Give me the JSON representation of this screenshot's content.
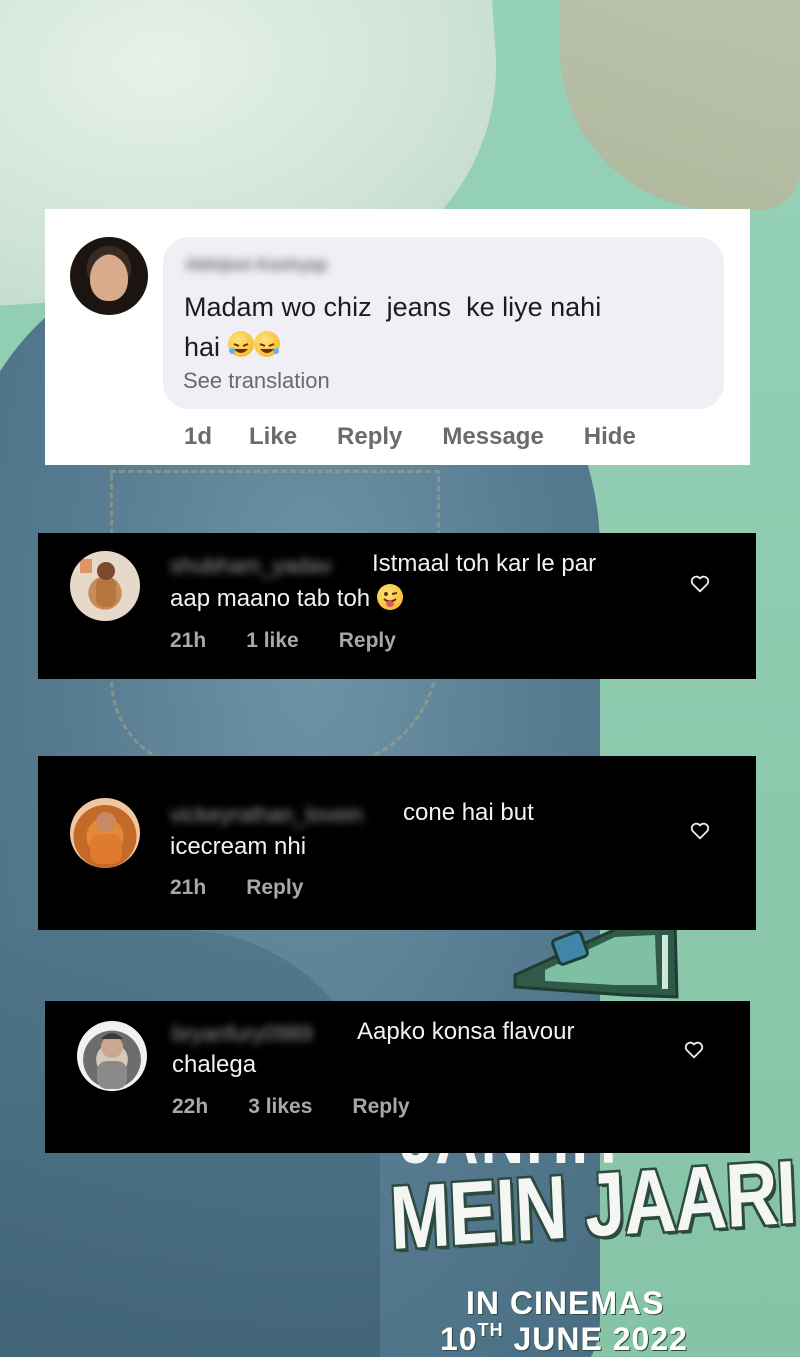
{
  "poster": {
    "title_top": "JANHIT",
    "title_main": "MEIN JAARI",
    "cinemas_line": "IN CINEMAS",
    "release_day": "10",
    "release_suffix": "TH",
    "release_rest": "JUNE 2022"
  },
  "facebook_comment": {
    "author": "Abhijeet Kashyap",
    "text": "Madam wo chiz  jeans  ke liye nahi\nhai",
    "emoji": [
      "rolling-on-floor-laughing-emoji",
      "rolling-on-floor-laughing-emoji"
    ],
    "see_translation": "See translation",
    "time": "1d",
    "actions": [
      "Like",
      "Reply",
      "Message",
      "Hide"
    ]
  },
  "instagram_comments": [
    {
      "author": "shubham_yadav",
      "text_first": "Istmaal toh kar le par",
      "text_second": "aap maano tab toh",
      "emoji": "winking-face-with-tongue-emoji",
      "time": "21h",
      "likes": "1 like",
      "reply": "Reply"
    },
    {
      "author": "vickeyrathan_lovein",
      "text_first": "cone hai but",
      "text_second": "icecream nhi",
      "time": "21h",
      "reply": "Reply"
    },
    {
      "author": "bryanfury0989",
      "text_first": "Aapko konsa flavour",
      "text_second": "chalega",
      "time": "22h",
      "likes": "3 likes",
      "reply": "Reply"
    }
  ],
  "colors": {
    "background": "#8fcaae",
    "fb_card": "#ffffff",
    "fb_bubble": "#f0eff6",
    "ig_card": "#000000",
    "ig_meta": "#a8a8a8"
  },
  "icons": [
    "heart-outline-icon",
    "megaphone-icon"
  ]
}
